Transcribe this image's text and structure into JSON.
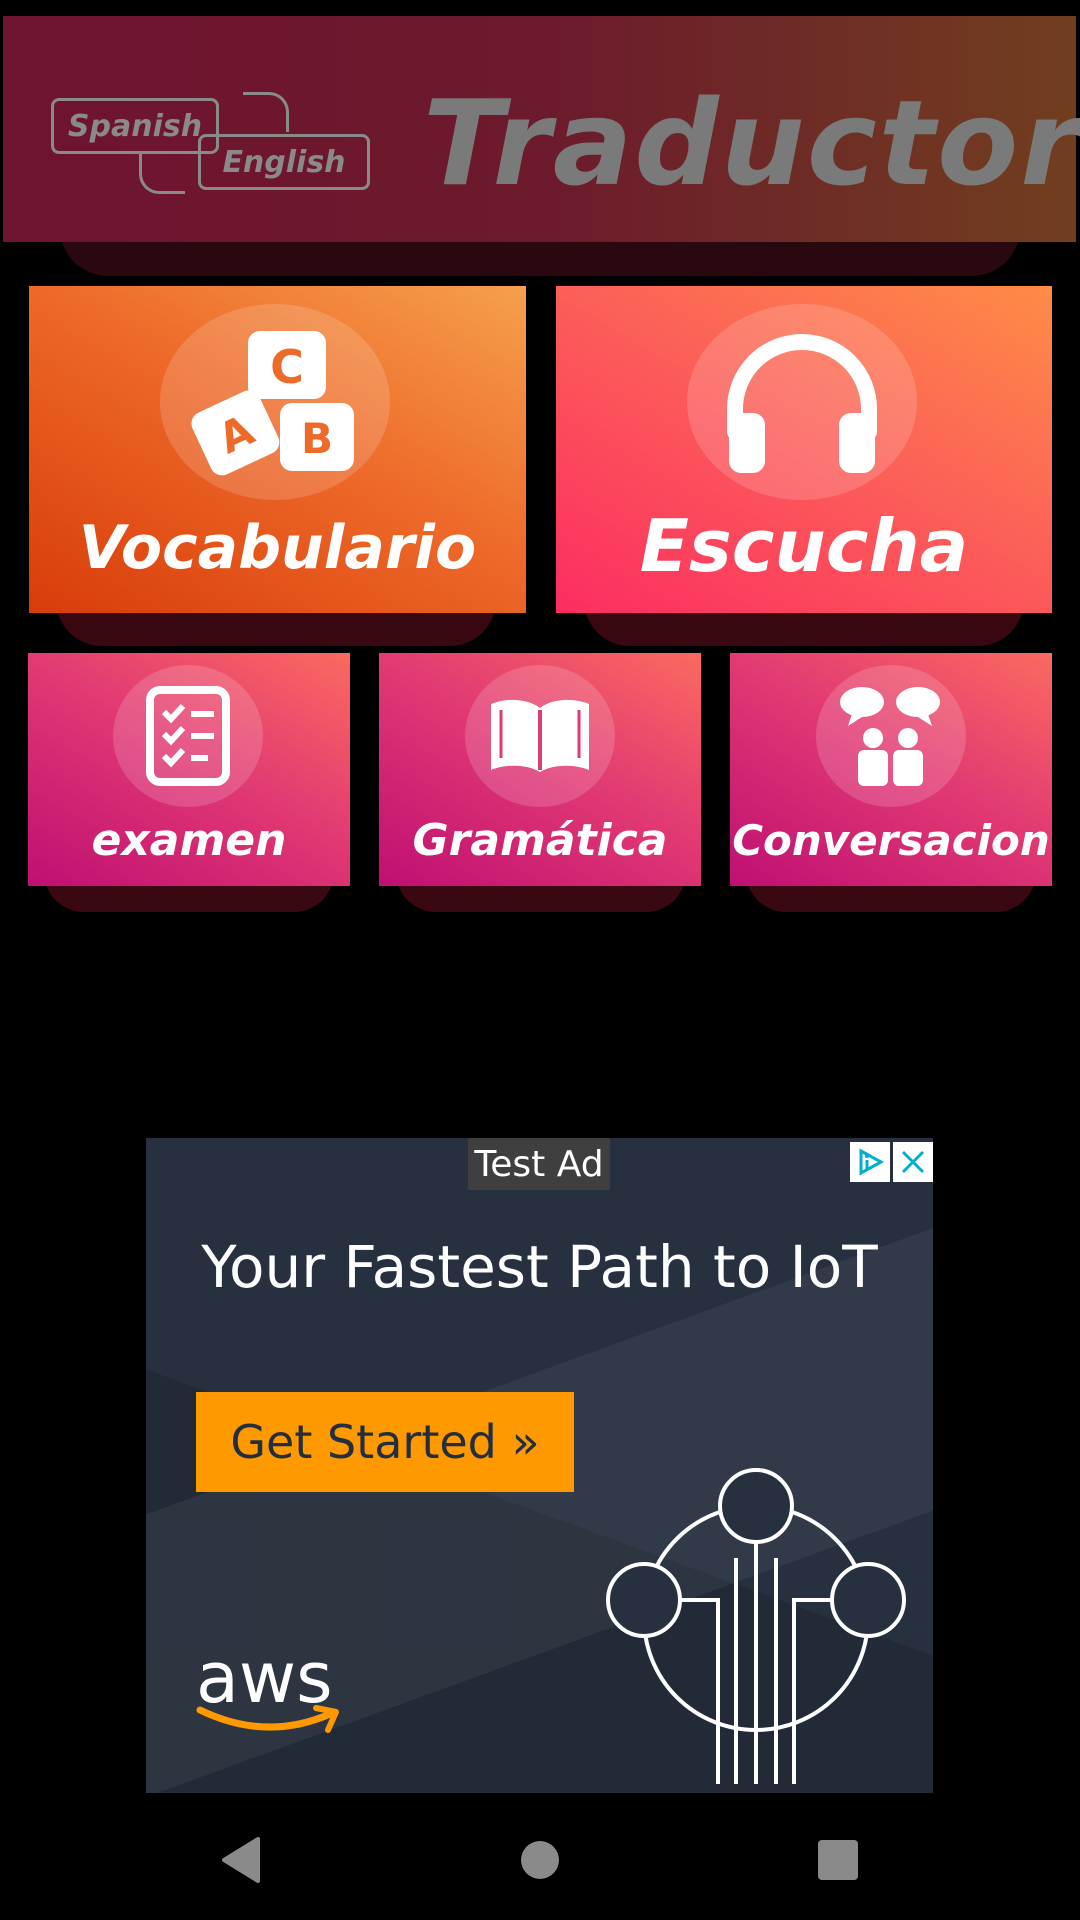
{
  "header": {
    "logo_top": "Spanish",
    "logo_bottom": "English",
    "title": "Traductor"
  },
  "tiles": {
    "vocabulario": {
      "label": "Vocabulario",
      "icon": "abc-blocks-icon"
    },
    "escucha": {
      "label": "Escucha",
      "icon": "headphones-icon"
    },
    "examen": {
      "label": "examen",
      "icon": "checklist-icon"
    },
    "gramatica": {
      "label": "Gramática",
      "icon": "open-book-icon"
    },
    "conversacion": {
      "label": "Conversacion",
      "icon": "chat-people-icon"
    }
  },
  "ad": {
    "badge": "Test Ad",
    "headline": "Your Fastest Path to IoT",
    "cta": "Get Started »",
    "brand": "aws",
    "colors": {
      "background": "#27303f",
      "cta": "#ff9900"
    }
  },
  "navbar": {
    "icons": [
      "back-icon",
      "home-icon",
      "recents-icon"
    ]
  },
  "colors": {
    "header_start": "#6e1330",
    "header_end": "#713e1f",
    "vocab_start": "#d83c0a",
    "vocab_end": "#f5a04c",
    "escucha_start": "#fc2d61",
    "escucha_end": "#fe8c45",
    "small_start": "#bf0f73",
    "small_end": "#fb6a5f"
  }
}
